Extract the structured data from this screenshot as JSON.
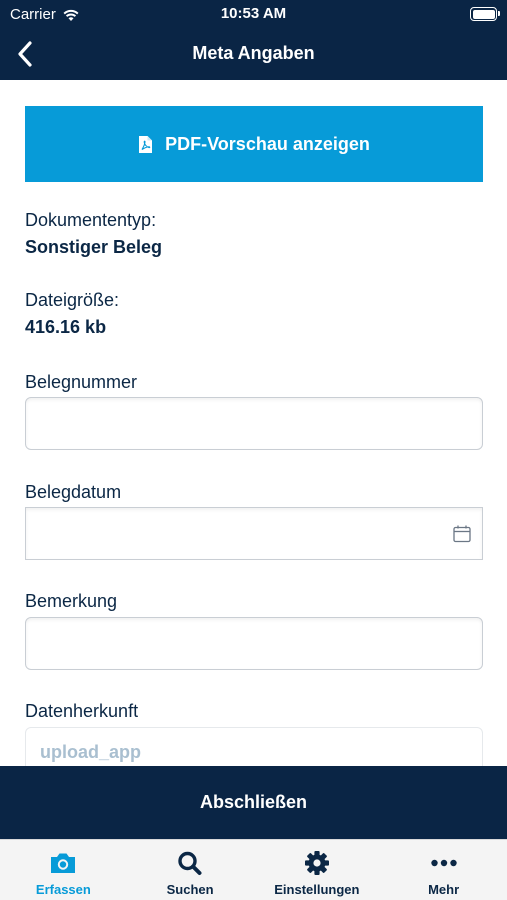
{
  "status_bar": {
    "carrier": "Carrier",
    "time": "10:53 AM"
  },
  "nav": {
    "title": "Meta Angaben",
    "back_icon": "chevron-left-icon"
  },
  "pdf_button": {
    "label": "PDF-Vorschau anzeigen",
    "icon": "pdf-file-icon"
  },
  "info": {
    "doctype_label": "Dokumententyp:",
    "doctype_value": "Sonstiger Beleg",
    "size_label": "Dateigröße:",
    "size_value": "416.16 kb"
  },
  "form": {
    "belegnummer_label": "Belegnummer",
    "belegnummer_value": "",
    "belegdatum_label": "Belegdatum",
    "belegdatum_value": "",
    "bemerkung_label": "Bemerkung",
    "bemerkung_value": "",
    "datenherkunft_label": "Datenherkunft",
    "datenherkunft_value": "upload_app"
  },
  "submit": {
    "label": "Abschließen"
  },
  "tabs": [
    {
      "label": "Erfassen",
      "icon": "camera-icon",
      "active": true
    },
    {
      "label": "Suchen",
      "icon": "search-icon",
      "active": false
    },
    {
      "label": "Einstellungen",
      "icon": "gear-icon",
      "active": false
    },
    {
      "label": "Mehr",
      "icon": "more-dots-icon",
      "active": false
    }
  ],
  "colors": {
    "navy": "#0a2545",
    "accent": "#079bd8"
  }
}
